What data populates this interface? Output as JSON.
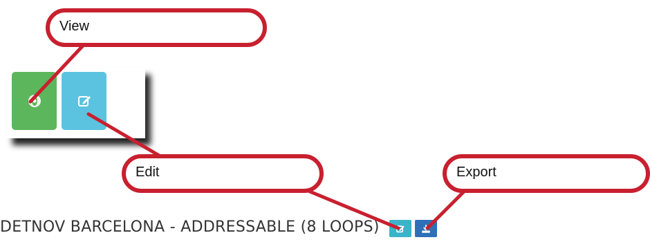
{
  "annotations": {
    "view_label": "View",
    "edit_label": "Edit",
    "export_label": "Export"
  },
  "panel": {
    "title": "DETNOV BARCELONA - ADDRESSABLE (8 LOOPS)"
  },
  "icons": {
    "view": "eye-icon",
    "edit": "edit-icon",
    "export": "download-icon"
  },
  "colors": {
    "callout_border": "#c8202f",
    "view_button": "#5cb65c",
    "edit_button": "#5bc3df",
    "small_edit_button": "#3bb3c9",
    "export_button": "#2f6fb8"
  }
}
